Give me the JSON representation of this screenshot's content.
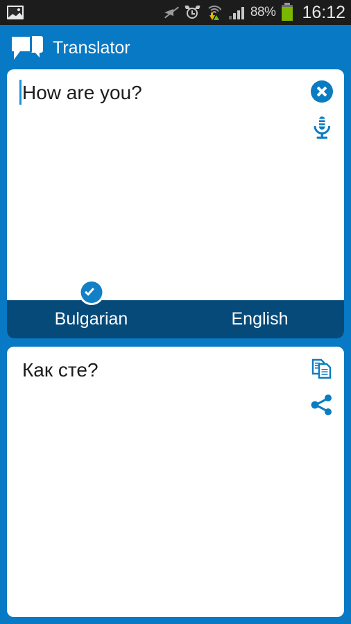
{
  "status_bar": {
    "notification_icon": "gallery-icon",
    "icons": [
      "mute-icon",
      "alarm-icon",
      "wifi-data-icon",
      "signal-icon"
    ],
    "battery_percent": "88%",
    "battery_icon": "battery-icon",
    "clock": "16:12"
  },
  "app_bar": {
    "icon": "chat-bubbles-icon",
    "title": "Translator"
  },
  "source": {
    "text": "How are you?",
    "clear_icon": "clear-circle-x-icon",
    "mic_icon": "microphone-icon"
  },
  "languages": {
    "source_language": "Bulgarian",
    "target_language": "English",
    "selected_badge": "check-badge-icon"
  },
  "target": {
    "text": "Как сте?",
    "copy_icon": "copy-icon",
    "share_icon": "share-icon"
  },
  "colors": {
    "accent_blue": "#0879C4",
    "dark_blue": "#064A79",
    "status_bar": "#1C1C1C",
    "battery_green": "#7AB800",
    "card_white": "#FFFFFF"
  }
}
